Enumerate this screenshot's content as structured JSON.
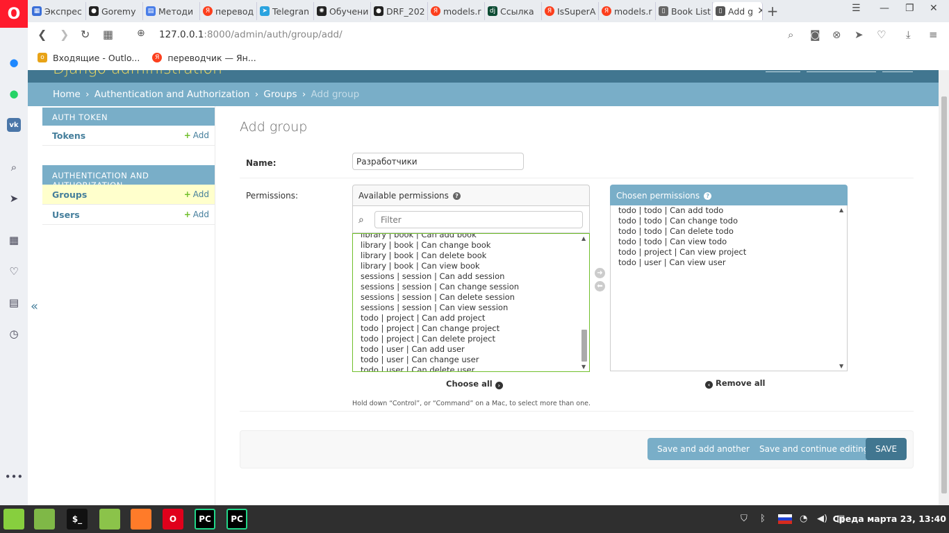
{
  "browser": {
    "tabs": [
      {
        "label": "Экспрес",
        "icon": "grid-icon",
        "color": "#3a6fd8"
      },
      {
        "label": "Goremy",
        "icon": "github-icon",
        "color": "#222222"
      },
      {
        "label": "Методи",
        "icon": "docs-icon",
        "color": "#4a7ee8"
      },
      {
        "label": "перевод",
        "icon": "yandex-icon",
        "color": "#fc3f1d"
      },
      {
        "label": "Telegran",
        "icon": "telegram-icon",
        "color": "#2aa3df"
      },
      {
        "label": "Обучени",
        "icon": "openai-icon",
        "color": "#222222"
      },
      {
        "label": "DRF_202",
        "icon": "github-icon",
        "color": "#222222"
      },
      {
        "label": "models.r",
        "icon": "yandex-icon",
        "color": "#fc3f1d"
      },
      {
        "label": "Ссылка",
        "icon": "django-icon",
        "color": "#0c4b33"
      },
      {
        "label": "IsSuperA",
        "icon": "yandex-icon",
        "color": "#fc3f1d"
      },
      {
        "label": "models.r",
        "icon": "yandex-icon",
        "color": "#fc3f1d"
      },
      {
        "label": "Book List",
        "icon": "page-icon",
        "color": "#666666"
      }
    ],
    "active_tab": {
      "label": "Add g",
      "icon": "page-icon"
    },
    "url_host": "127.0.0.1",
    "url_rest": ":8000/admin/auth/group/add/",
    "bookmarks": [
      {
        "label": "Входящие - Outlo...",
        "icon": "outlook-icon",
        "color": "#e8a317"
      },
      {
        "label": "переводчик — Ян...",
        "icon": "yandex-icon",
        "color": "#fc3f1d"
      }
    ]
  },
  "breadcrumbs": {
    "home": "Home",
    "app": "Authentication and Authorization",
    "model": "Groups",
    "current": "Add group",
    "separator": "›"
  },
  "header": {
    "brand": "Django administration"
  },
  "sidebar": {
    "modules": [
      {
        "caption": "Auth Token",
        "models": [
          {
            "name": "Tokens",
            "add": "Add",
            "current": false
          }
        ]
      },
      {
        "caption": "Authentication and Authorization",
        "models": [
          {
            "name": "Groups",
            "add": "Add",
            "current": true
          },
          {
            "name": "Users",
            "add": "Add",
            "current": false
          }
        ]
      }
    ],
    "toggle": "«"
  },
  "form": {
    "title": "Add group",
    "name_label": "Name:",
    "name_value": "Разработчики",
    "permissions_label": "Permissions:",
    "available_caption": "Available permissions",
    "chosen_caption": "Chosen permissions",
    "filter_placeholder": "Filter",
    "available_options": [
      "library | book | Can add book",
      "library | book | Can change book",
      "library | book | Can delete book",
      "library | book | Can view book",
      "sessions | session | Can add session",
      "sessions | session | Can change session",
      "sessions | session | Can delete session",
      "sessions | session | Can view session",
      "todo | project | Can add project",
      "todo | project | Can change project",
      "todo | project | Can delete project",
      "todo | user | Can add user",
      "todo | user | Can change user",
      "todo | user | Can delete user"
    ],
    "chosen_options": [
      "todo | todo | Can add todo",
      "todo | todo | Can change todo",
      "todo | todo | Can delete todo",
      "todo | todo | Can view todo",
      "todo | project | Can view project",
      "todo | user | Can view user"
    ],
    "choose_all": "Choose all",
    "remove_all": "Remove all",
    "help_text": "Hold down “Control”, or “Command” on a Mac, to select more than one.",
    "buttons": {
      "save_add_another": "Save and add another",
      "save_continue": "Save and continue editing",
      "save": "SAVE"
    }
  },
  "taskbar": {
    "clock": "Среда марта 23, 13:40",
    "apps": [
      {
        "name": "mint-menu-icon",
        "label": "",
        "color": "#87cf3e"
      },
      {
        "name": "files-icon",
        "label": "",
        "color": "#7fb847"
      },
      {
        "name": "terminal-icon",
        "label": "$_",
        "color": "#111111"
      },
      {
        "name": "folder-icon",
        "label": "",
        "color": "#8bc34a"
      },
      {
        "name": "firefox-icon",
        "label": "",
        "color": "#ff7b29"
      },
      {
        "name": "opera-icon",
        "label": "O",
        "color": "#e0001b"
      },
      {
        "name": "pycharm-icon",
        "label": "PC",
        "color": "#21d789"
      },
      {
        "name": "pycharm-icon",
        "label": "PC",
        "color": "#21d789"
      }
    ]
  }
}
